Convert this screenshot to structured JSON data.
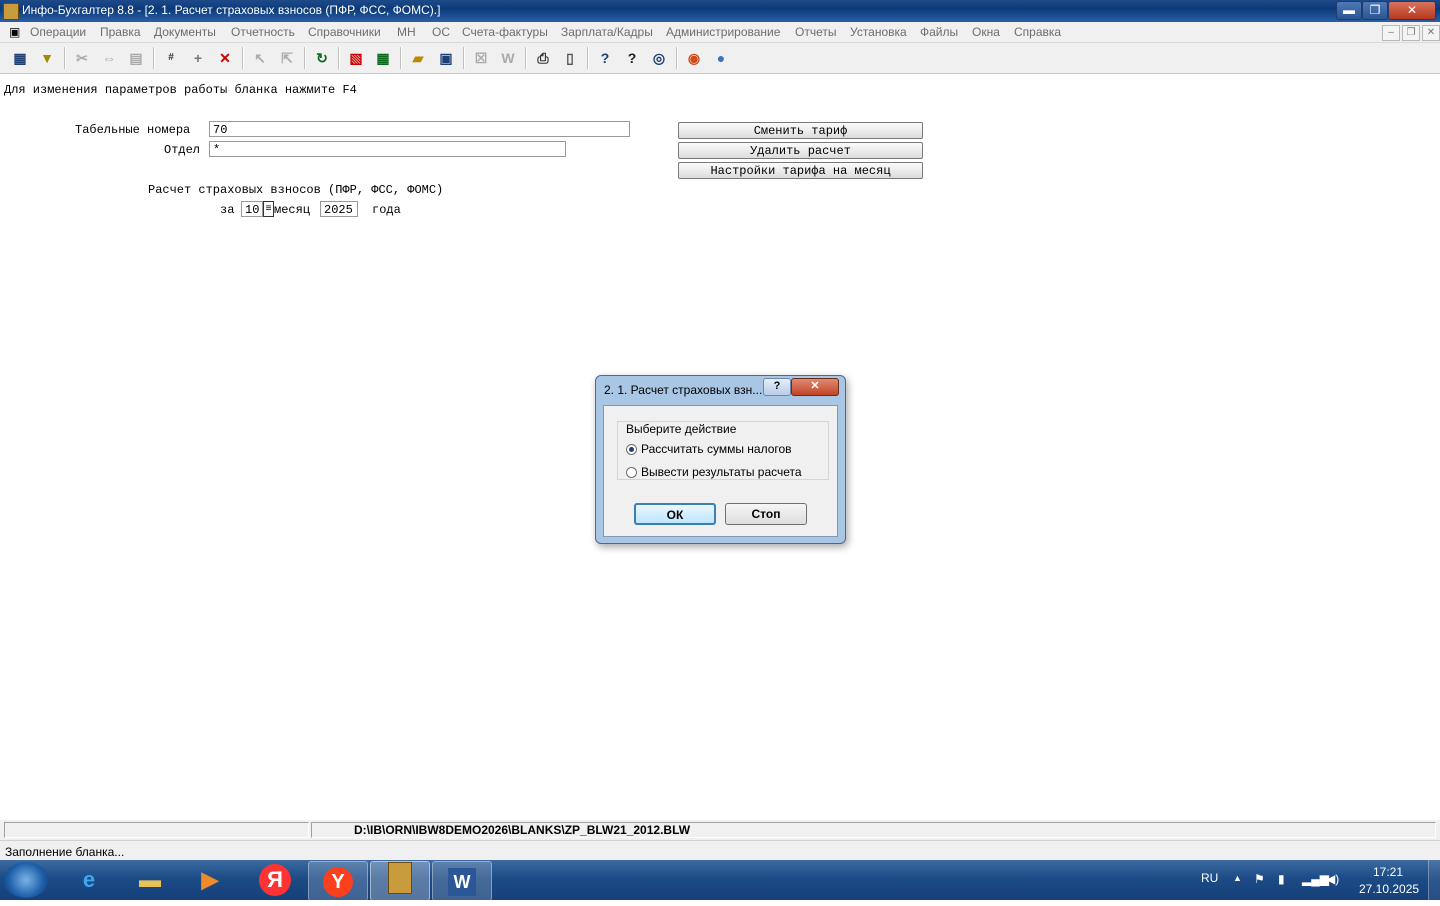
{
  "window": {
    "title": "Инфо-Бухгалтер 8.8 - [2. 1. Расчет страховых взносов (ПФР, ФСС, ФОМС).]",
    "controls": {
      "minimize": "▬",
      "maximize": "❐",
      "close": "✕"
    }
  },
  "menu": {
    "items": [
      "Операции",
      "Правка",
      "Документы",
      "Отчетность",
      "Справочники",
      "МН",
      "ОС",
      "Счета-фактуры",
      "Зарплата/Кадры",
      "Администрирование",
      "Отчеты",
      "Установка",
      "Файлы",
      "Окна",
      "Справка"
    ],
    "mdi_controls": {
      "minimize": "–",
      "restore": "❐",
      "close": "✕"
    }
  },
  "toolbar": {
    "icons": [
      "grid-icon",
      "filter-icon",
      "cut-icon",
      "copy-icon",
      "paste-icon",
      "renumber-icon",
      "add-icon",
      "delete-icon",
      "select-icon",
      "select-all-icon",
      "refresh-icon",
      "pdf-icon",
      "calculator-icon",
      "open-folder-icon",
      "save-icon",
      "excel-icon",
      "word-icon",
      "print-icon",
      "preview-icon",
      "help-icon",
      "context-help-icon",
      "compass-icon",
      "lifebuoy-icon",
      "globe-icon"
    ]
  },
  "form": {
    "hint": "Для изменения параметров работы бланка нажмите F4",
    "tab_numbers_label": "Табельные номера",
    "tab_numbers_value": "70",
    "department_label": "Отдел",
    "department_value": "*",
    "calc_title": "Расчет страховых взносов (ПФР, ФСС, ФОМС)",
    "for_label": "за",
    "month_value": "10",
    "month_label": "месяц",
    "year_value": "2025",
    "year_label": "года",
    "btn_change_tariff": "Сменить тариф",
    "btn_delete_calc": "Удалить расчет",
    "btn_tariff_settings": "Настройки тарифа на месяц"
  },
  "dialog": {
    "title": "2. 1. Расчет страховых взн...",
    "group_label": "Выберите действие",
    "option_calc": "Рассчитать суммы налогов",
    "option_output": "Вывести результаты расчета",
    "selected": "option_calc",
    "ok": "ОК",
    "stop": "Стоп",
    "help": "?",
    "close": "✕"
  },
  "status": {
    "path": "D:\\IB\\ORN\\IBW8DEMO2026\\BLANKS\\ZP_BLW21_2012.BLW",
    "message": "Заполнение бланка..."
  },
  "taskbar": {
    "lang": "RU",
    "time": "17:21",
    "date": "27.10.2025",
    "apps": [
      "start-button",
      "ie-icon",
      "explorer-icon",
      "media-player-icon",
      "yandex-icon",
      "yandex-browser-icon",
      "info-accountant-icon",
      "word-icon"
    ]
  },
  "colors": {
    "titlebar": "#0c3a78",
    "taskbar": "#1c4b86",
    "dialog_frame": "#a9c6e4",
    "menu_text": "#6d6d6d"
  }
}
